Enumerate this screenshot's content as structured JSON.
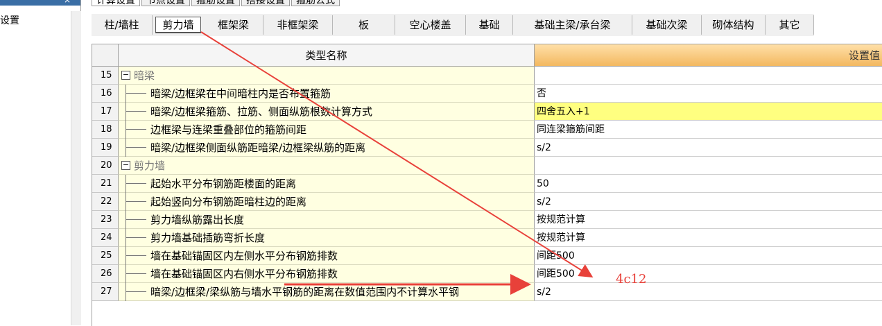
{
  "left_panel": {
    "close": "×",
    "item": "设置"
  },
  "top_tabs": [
    "计算设置",
    "节点设置",
    "箍筋设置",
    "搭接设置",
    "箍筋公式"
  ],
  "category_tabs": [
    "柱/墙柱",
    "剪力墙",
    "框架梁",
    "非框架梁",
    "板",
    "空心楼盖",
    "基础",
    "基础主梁/承台梁",
    "基础次梁",
    "砌体结构",
    "其它"
  ],
  "active_category": "剪力墙",
  "table": {
    "header_name": "类型名称",
    "header_value": "设置值",
    "rows": [
      {
        "num": "15",
        "name": "暗梁",
        "value": "",
        "category": true
      },
      {
        "num": "16",
        "name": "暗梁/边框梁在中间暗柱内是否布置箍筋",
        "value": "否"
      },
      {
        "num": "17",
        "name": "暗梁/边框梁箍筋、拉筋、侧面纵筋根数计算方式",
        "value": "四舍五入+1",
        "highlight": true
      },
      {
        "num": "18",
        "name": "边框梁与连梁重叠部位的箍筋间距",
        "value": "同连梁箍筋间距"
      },
      {
        "num": "19",
        "name": "暗梁/边框梁侧面纵筋距暗梁/边框梁纵筋的距离",
        "value": "s/2"
      },
      {
        "num": "20",
        "name": "剪力墙",
        "value": "",
        "category": true
      },
      {
        "num": "21",
        "name": "起始水平分布钢筋距楼面的距离",
        "value": "50"
      },
      {
        "num": "22",
        "name": "起始竖向分布钢筋距暗柱边的距离",
        "value": "s/2"
      },
      {
        "num": "23",
        "name": "剪力墙纵筋露出长度",
        "value": "按规范计算"
      },
      {
        "num": "24",
        "name": "剪力墙基础插筋弯折长度",
        "value": "按规范计算"
      },
      {
        "num": "25",
        "name": "墙在基础锚固区内左侧水平分布钢筋排数",
        "value": "间距500"
      },
      {
        "num": "26",
        "name": "墙在基础锚固区内右侧水平分布钢筋排数",
        "value": "间距500"
      },
      {
        "num": "27",
        "name": "暗梁/边框梁/梁纵筋与墙水平钢筋的距离在数值范围内不计算水平钢",
        "value": "s/2"
      }
    ]
  },
  "annotation": {
    "label": "4c12",
    "color": "#e8413a"
  }
}
